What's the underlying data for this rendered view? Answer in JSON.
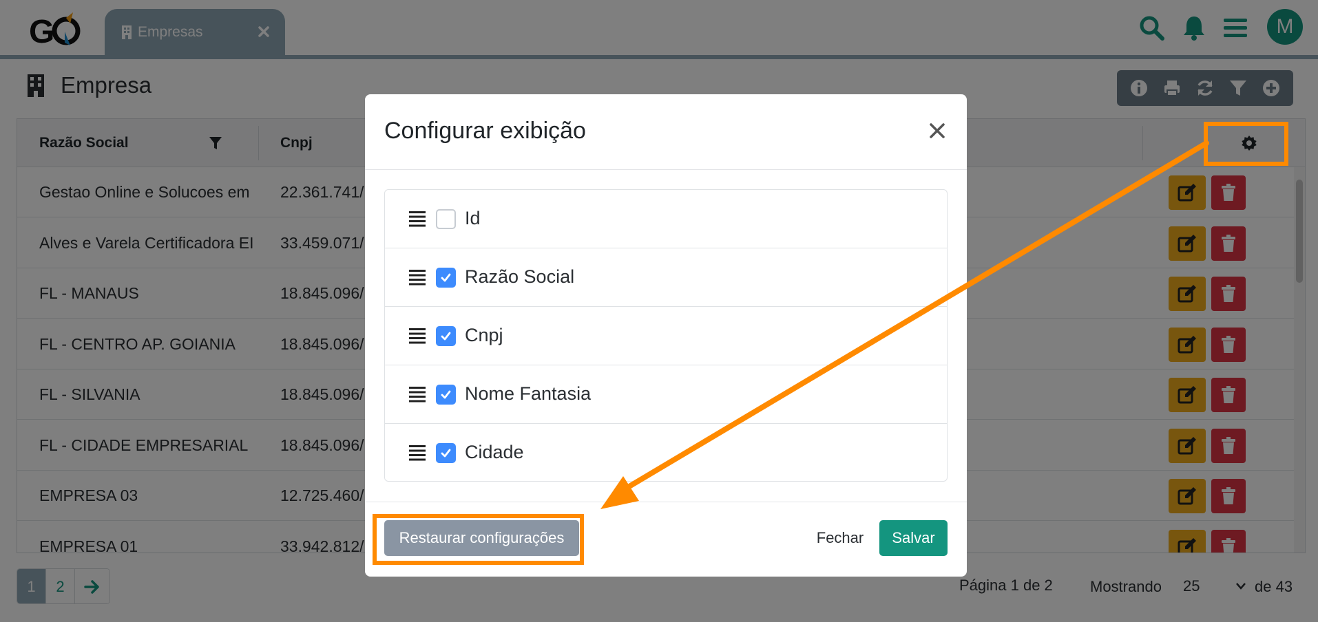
{
  "app": {
    "tab_label": "Empresas"
  },
  "header": {
    "avatar_initial": "M"
  },
  "page": {
    "title": "Empresa"
  },
  "table": {
    "columns": [
      "Razão Social",
      "Cnpj"
    ],
    "rows": [
      {
        "razao": "Gestao Online e Solucoes em",
        "cnpj": "22.361.741/"
      },
      {
        "razao": "Alves e Varela Certificadora EI",
        "cnpj": "33.459.071/"
      },
      {
        "razao": "FL - MANAUS",
        "cnpj": "18.845.096/"
      },
      {
        "razao": "FL - CENTRO AP. GOIANIA",
        "cnpj": "18.845.096/"
      },
      {
        "razao": "FL - SILVANIA",
        "cnpj": "18.845.096/"
      },
      {
        "razao": "FL - CIDADE EMPRESARIAL",
        "cnpj": "18.845.096/"
      },
      {
        "razao": "EMPRESA 03",
        "cnpj": "12.725.460/"
      },
      {
        "razao": "EMPRESA 01",
        "cnpj": "33.942.812/"
      }
    ]
  },
  "pagination": {
    "pages": [
      "1",
      "2"
    ],
    "page_info": "Página 1 de 2",
    "showing_label": "Mostrando",
    "page_size": "25",
    "total": "de 43"
  },
  "modal": {
    "title": "Configurar exibição",
    "columns": [
      {
        "label": "Id",
        "checked": false
      },
      {
        "label": "Razão Social",
        "checked": true
      },
      {
        "label": "Cnpj",
        "checked": true
      },
      {
        "label": "Nome Fantasia",
        "checked": true
      },
      {
        "label": "Cidade",
        "checked": true
      }
    ],
    "restore_label": "Restaurar configurações",
    "close_label": "Fechar",
    "save_label": "Salvar"
  },
  "colors": {
    "accent": "#14957f",
    "tab": "#8fa7b5",
    "edit": "#f0ad1c",
    "delete": "#dc3545",
    "highlight": "#ff8a00"
  }
}
